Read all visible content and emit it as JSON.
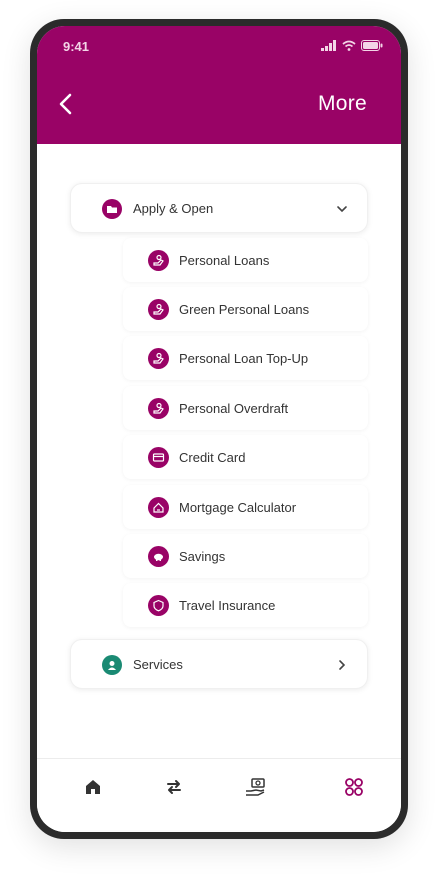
{
  "status_bar": {
    "time": "9:41"
  },
  "header": {
    "title": "More"
  },
  "groups": [
    {
      "label": "Apply & Open",
      "icon": "folder-icon",
      "color": "#990366",
      "expanded": true
    },
    {
      "label": "Services",
      "icon": "services-icon",
      "color": "#1a8a73",
      "expanded": false
    }
  ],
  "items": [
    {
      "label": "Personal Loans",
      "icon": "loan-icon"
    },
    {
      "label": "Green Personal Loans",
      "icon": "loan-icon"
    },
    {
      "label": "Personal Loan Top-Up",
      "icon": "loan-icon"
    },
    {
      "label": "Personal Overdraft",
      "icon": "loan-icon"
    },
    {
      "label": "Credit Card",
      "icon": "credit-card-icon"
    },
    {
      "label": "Mortgage Calculator",
      "icon": "mortgage-icon"
    },
    {
      "label": "Savings",
      "icon": "piggy-bank-icon"
    },
    {
      "label": "Travel Insurance",
      "icon": "shield-icon"
    }
  ],
  "nav": [
    {
      "icon": "home-icon",
      "active": false
    },
    {
      "icon": "transfer-icon",
      "active": false
    },
    {
      "icon": "payments-icon",
      "active": false
    },
    {
      "icon": "more-grid-icon",
      "active": true
    }
  ],
  "colors": {
    "brand": "#990366",
    "services": "#1a8a73",
    "nav_inactive": "#333333"
  }
}
